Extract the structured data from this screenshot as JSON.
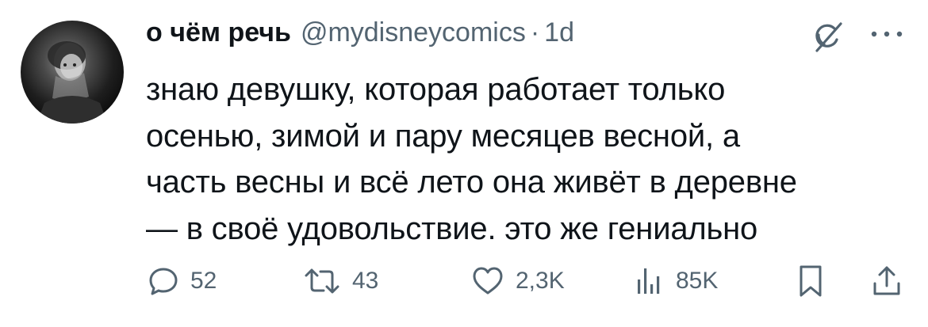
{
  "tweet": {
    "author_name": "о чём речь",
    "handle": "@mydisneycomics",
    "separator": "·",
    "time": "1d",
    "text": "знаю девушку, которая работает только\nосенью, зимой и пару месяцев весной, а\nчасть весны и всё лето она живёт в деревне\n— в своё удовольствие. это же гениально"
  },
  "icons": {
    "grok": "grok-icon",
    "more": "more-icon",
    "reply": "reply-icon",
    "retweet": "retweet-icon",
    "like": "heart-icon",
    "views": "views-chart-icon",
    "bookmark": "bookmark-icon",
    "share": "share-icon"
  },
  "actions": {
    "replies": "52",
    "retweets": "43",
    "likes": "2,3K",
    "views": "85K"
  },
  "colors": {
    "text": "#0f1419",
    "secondary": "#536471",
    "background": "#ffffff"
  }
}
